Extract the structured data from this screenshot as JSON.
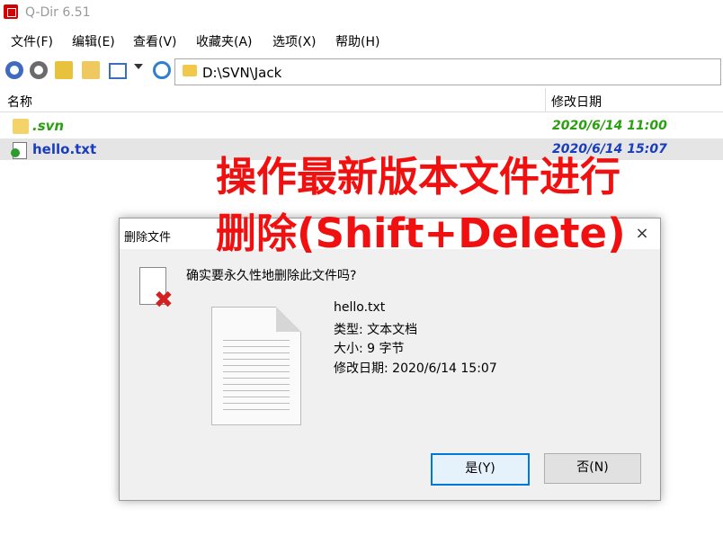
{
  "app": {
    "title": "Q-Dir 6.51"
  },
  "menu": [
    "文件(F)",
    "编辑(E)",
    "查看(V)",
    "收藏夹(A)",
    "选项(X)",
    "帮助(H)"
  ],
  "address": {
    "path": "D:\\SVN\\Jack"
  },
  "columns": {
    "name": "名称",
    "modified": "修改日期"
  },
  "files": [
    {
      "name": ".svn",
      "date": "2020/6/14 11:00"
    },
    {
      "name": "hello.txt",
      "date": "2020/6/14 15:07"
    }
  ],
  "annotation": {
    "line1": "操作最新版本文件进行",
    "line2": "删除(Shift+Delete)"
  },
  "dialog": {
    "title": "删除文件",
    "close": "×",
    "question": "确实要永久性地删除此文件吗?",
    "file_name": "hello.txt",
    "type_line": "类型: 文本文档",
    "size_line": "大小: 9 字节",
    "modified_line": "修改日期: 2020/6/14 15:07",
    "yes_label": "是(Y)",
    "no_label": "否(N)"
  },
  "colors": {
    "svn": "#2aa010",
    "selected_text": "#1a3dbd",
    "annotation": "#f01010",
    "accent": "#0078d7"
  }
}
